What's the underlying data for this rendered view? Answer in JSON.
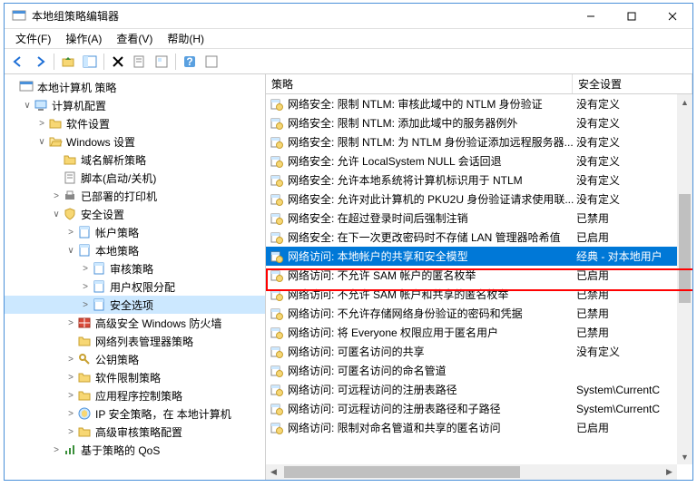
{
  "window": {
    "title": "本地组策略编辑器"
  },
  "menu": {
    "file": "文件(F)",
    "action": "操作(A)",
    "view": "查看(V)",
    "help": "帮助(H)"
  },
  "tree": [
    {
      "level": 0,
      "toggle": "",
      "icon": "console",
      "label": "本地计算机 策略"
    },
    {
      "level": 1,
      "toggle": "∨",
      "icon": "computer",
      "label": "计算机配置"
    },
    {
      "level": 2,
      "toggle": ">",
      "icon": "folder",
      "label": "软件设置"
    },
    {
      "level": 2,
      "toggle": "∨",
      "icon": "folder-open",
      "label": "Windows 设置"
    },
    {
      "level": 3,
      "toggle": "",
      "icon": "folder",
      "label": "域名解析策略"
    },
    {
      "level": 3,
      "toggle": "",
      "icon": "script",
      "label": "脚本(启动/关机)"
    },
    {
      "level": 3,
      "toggle": ">",
      "icon": "printer",
      "label": "已部署的打印机"
    },
    {
      "level": 3,
      "toggle": "∨",
      "icon": "security",
      "label": "安全设置"
    },
    {
      "level": 4,
      "toggle": ">",
      "icon": "policy",
      "label": "帐户策略"
    },
    {
      "level": 4,
      "toggle": "∨",
      "icon": "policy",
      "label": "本地策略"
    },
    {
      "level": 5,
      "toggle": ">",
      "icon": "policy",
      "label": "审核策略"
    },
    {
      "level": 5,
      "toggle": ">",
      "icon": "policy",
      "label": "用户权限分配"
    },
    {
      "level": 5,
      "toggle": ">",
      "icon": "policy",
      "label": "安全选项",
      "selected": true
    },
    {
      "level": 4,
      "toggle": ">",
      "icon": "firewall",
      "label": "高级安全 Windows 防火墙"
    },
    {
      "level": 4,
      "toggle": "",
      "icon": "folder",
      "label": "网络列表管理器策略"
    },
    {
      "level": 4,
      "toggle": ">",
      "icon": "key",
      "label": "公钥策略"
    },
    {
      "level": 4,
      "toggle": ">",
      "icon": "folder",
      "label": "软件限制策略"
    },
    {
      "level": 4,
      "toggle": ">",
      "icon": "folder",
      "label": "应用程序控制策略"
    },
    {
      "level": 4,
      "toggle": ">",
      "icon": "ipsec",
      "label": "IP 安全策略，在 本地计算机"
    },
    {
      "level": 4,
      "toggle": ">",
      "icon": "folder",
      "label": "高级审核策略配置"
    },
    {
      "level": 3,
      "toggle": ">",
      "icon": "qos",
      "label": "基于策略的 QoS"
    }
  ],
  "columns": {
    "policy": "策略",
    "setting": "安全设置"
  },
  "policies": [
    {
      "name": "网络安全: 限制 NTLM: 审核此域中的 NTLM 身份验证",
      "value": "没有定义"
    },
    {
      "name": "网络安全: 限制 NTLM: 添加此域中的服务器例外",
      "value": "没有定义"
    },
    {
      "name": "网络安全: 限制 NTLM: 为 NTLM 身份验证添加远程服务器...",
      "value": "没有定义"
    },
    {
      "name": "网络安全: 允许 LocalSystem NULL 会话回退",
      "value": "没有定义"
    },
    {
      "name": "网络安全: 允许本地系统将计算机标识用于 NTLM",
      "value": "没有定义"
    },
    {
      "name": "网络安全: 允许对此计算机的 PKU2U 身份验证请求使用联...",
      "value": "没有定义"
    },
    {
      "name": "网络安全: 在超过登录时间后强制注销",
      "value": "已禁用"
    },
    {
      "name": "网络安全: 在下一次更改密码时不存储 LAN 管理器哈希值",
      "value": "已启用"
    },
    {
      "name": "网络访问: 本地帐户的共享和安全模型",
      "value": "经典 - 对本地用户",
      "selected": true
    },
    {
      "name": "网络访问: 不允许 SAM 帐户的匿名枚举",
      "value": "已启用"
    },
    {
      "name": "网络访问: 不允许 SAM 帐户和共享的匿名枚举",
      "value": "已禁用"
    },
    {
      "name": "网络访问: 不允许存储网络身份验证的密码和凭据",
      "value": "已禁用"
    },
    {
      "name": "网络访问: 将 Everyone 权限应用于匿名用户",
      "value": "已禁用"
    },
    {
      "name": "网络访问: 可匿名访问的共享",
      "value": "没有定义"
    },
    {
      "name": "网络访问: 可匿名访问的命名管道",
      "value": ""
    },
    {
      "name": "网络访问: 可远程访问的注册表路径",
      "value": "System\\CurrentC"
    },
    {
      "name": "网络访问: 可远程访问的注册表路径和子路径",
      "value": "System\\CurrentC"
    },
    {
      "name": "网络访问: 限制对命名管道和共享的匿名访问",
      "value": "已启用"
    }
  ]
}
